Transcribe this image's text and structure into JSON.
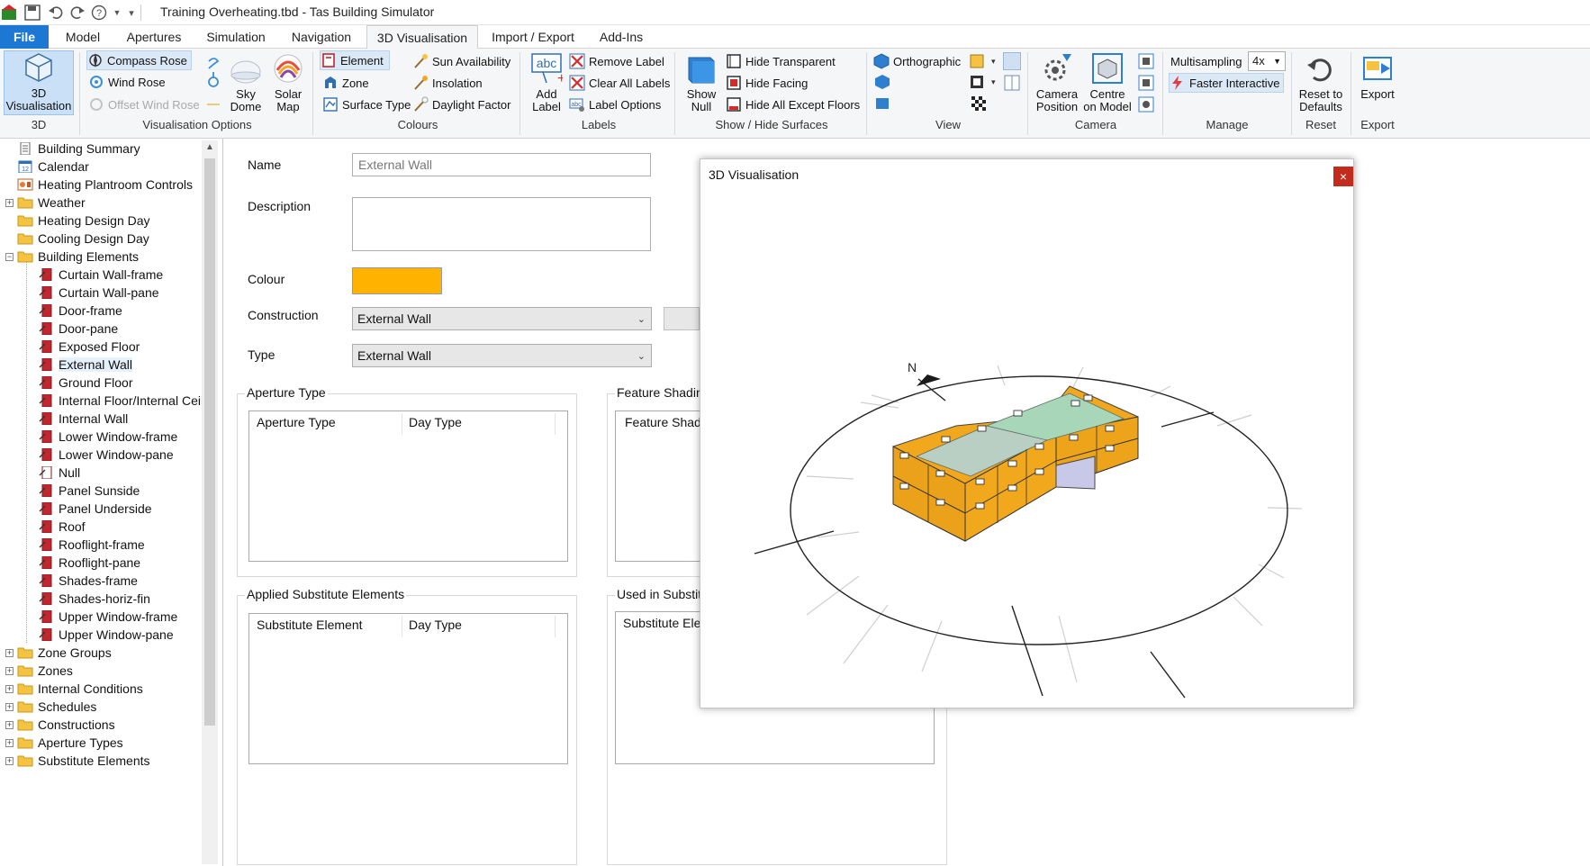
{
  "title_bar": {
    "title": "Training Overheating.tbd - Tas Building Simulator"
  },
  "tabs": [
    {
      "label": "File"
    },
    {
      "label": "Model"
    },
    {
      "label": "Apertures"
    },
    {
      "label": "Simulation"
    },
    {
      "label": "Navigation"
    },
    {
      "label": "3D Visualisation"
    },
    {
      "label": "Import / Export"
    },
    {
      "label": "Add-Ins"
    }
  ],
  "ribbon": {
    "g3d": {
      "btn_line1": "3D",
      "btn_line2": "Visualisation",
      "label": "3D"
    },
    "vis": {
      "compass_rose": "Compass Rose",
      "wind_rose": "Wind Rose",
      "offset_wind_rose": "Offset Wind Rose",
      "sky_l1": "Sky",
      "sky_l2": "Dome",
      "solar_l1": "Solar",
      "solar_l2": "Map",
      "label": "Visualisation Options"
    },
    "colours": {
      "element": "Element",
      "zone": "Zone",
      "surface_type": "Surface Type",
      "sun_availability": "Sun Availability",
      "insolation": "Insolation",
      "daylight_factor": "Daylight Factor",
      "label": "Colours"
    },
    "labels": {
      "add_l1": "Add",
      "add_l2": "Label",
      "remove_label": "Remove Label",
      "clear_all": "Clear All Labels",
      "label_options": "Label Options",
      "label": "Labels"
    },
    "show": {
      "show_l1": "Show",
      "show_l2": "Null",
      "hide_transparent": "Hide Transparent",
      "hide_facing": "Hide Facing",
      "hide_all_except": "Hide All Except Floors",
      "label": "Show / Hide Surfaces"
    },
    "view": {
      "orthographic": "Orthographic",
      "label": "View"
    },
    "camera": {
      "cam_l1": "Camera",
      "cam_l2": "Position",
      "centre_l1": "Centre",
      "centre_l2": "on Model",
      "label": "Camera"
    },
    "manage": {
      "multisampling": "Multisampling",
      "ms_value": "4x",
      "faster_interactive": "Faster Interactive",
      "label": "Manage"
    },
    "reset": {
      "l1": "Reset to",
      "l2": "Defaults",
      "label": "Reset"
    },
    "export": {
      "btn": "Export",
      "label": "Export"
    }
  },
  "tree": {
    "items": [
      {
        "label": "Building Summary"
      },
      {
        "label": "Calendar"
      },
      {
        "label": "Heating Plantroom Controls"
      },
      {
        "label": "Weather"
      },
      {
        "label": "Heating Design Day"
      },
      {
        "label": "Cooling Design Day"
      },
      {
        "label": "Building Elements"
      },
      {
        "label": "Curtain Wall-frame"
      },
      {
        "label": "Curtain Wall-pane"
      },
      {
        "label": "Door-frame"
      },
      {
        "label": "Door-pane"
      },
      {
        "label": "Exposed Floor"
      },
      {
        "label": "External Wall"
      },
      {
        "label": "Ground Floor"
      },
      {
        "label": "Internal Floor/Internal Ceili"
      },
      {
        "label": "Internal Wall"
      },
      {
        "label": "Lower Window-frame"
      },
      {
        "label": "Lower Window-pane"
      },
      {
        "label": "Null"
      },
      {
        "label": "Panel Sunside"
      },
      {
        "label": "Panel Underside"
      },
      {
        "label": "Roof"
      },
      {
        "label": "Rooflight-frame"
      },
      {
        "label": "Rooflight-pane"
      },
      {
        "label": "Shades-frame"
      },
      {
        "label": "Shades-horiz-fin"
      },
      {
        "label": "Upper Window-frame"
      },
      {
        "label": "Upper Window-pane"
      },
      {
        "label": "Zone Groups"
      },
      {
        "label": "Zones"
      },
      {
        "label": "Internal Conditions"
      },
      {
        "label": "Schedules"
      },
      {
        "label": "Constructions"
      },
      {
        "label": "Aperture Types"
      },
      {
        "label": "Substitute Elements"
      }
    ]
  },
  "form": {
    "name_label": "Name",
    "name_value": "External Wall",
    "description_label": "Description",
    "colour_label": "Colour",
    "colour_value": "#ffb300",
    "construction_label": "Construction",
    "construction_value": "External Wall",
    "type_label": "Type",
    "type_value": "External Wall",
    "aperture_group": "Aperture Type",
    "aperture_col1": "Aperture Type",
    "aperture_col2": "Day Type",
    "feature_group": "Feature Shading",
    "feature_col1": "Feature Shade",
    "applied_group": "Applied Substitute Elements",
    "applied_col1": "Substitute Element",
    "applied_col2": "Day Type",
    "used_group": "Used in Substitu",
    "used_col1": "Substitute Elem"
  },
  "viz": {
    "title": "3D Visualisation",
    "close": "×",
    "north_label": "N"
  },
  "colors": {
    "accent": "#1d78d4",
    "building": "#f2a81d",
    "close": "#c42b1c"
  }
}
